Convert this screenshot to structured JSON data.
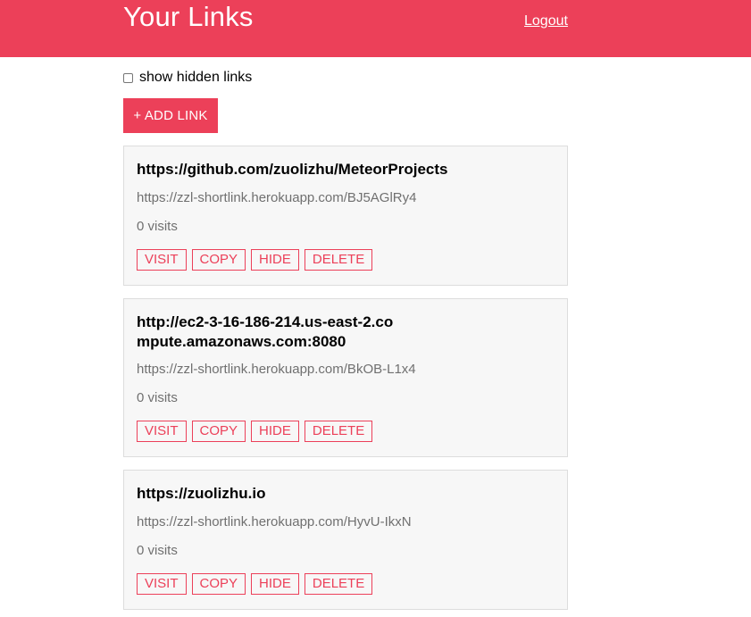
{
  "header": {
    "title": "Your Links",
    "logout_label": "Logout"
  },
  "filter": {
    "show_hidden_label": "show hidden links",
    "show_hidden_checked": false
  },
  "add_button_label": "+ ADD LINK",
  "links": [
    {
      "url": "https://github.com/zuolizhu/MeteorProjects",
      "short_url": "https://zzl-shortlink.herokuapp.com/BJ5AGlRy4",
      "visits": "0 visits",
      "actions": [
        "VISIT",
        "COPY",
        "HIDE",
        "DELETE"
      ]
    },
    {
      "url": "http://ec2-3-16-186-214.us-east-2.compute.amazonaws.com:8080",
      "short_url": "https://zzl-shortlink.herokuapp.com/BkOB-L1x4",
      "visits": "0 visits",
      "actions": [
        "VISIT",
        "COPY",
        "HIDE",
        "DELETE"
      ]
    },
    {
      "url": "https://zuolizhu.io",
      "short_url": "https://zzl-shortlink.herokuapp.com/HyvU-IkxN",
      "visits": "0 visits",
      "actions": [
        "VISIT",
        "COPY",
        "HIDE",
        "DELETE"
      ]
    }
  ],
  "colors": {
    "brand": "#ec4059",
    "card_bg": "#f7f7f7",
    "muted_text": "#707070"
  }
}
